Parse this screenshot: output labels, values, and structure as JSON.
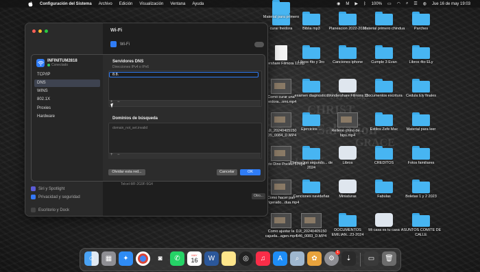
{
  "menubar": {
    "app_name": "Configuración del Sistema",
    "menus": [
      "Archivo",
      "Edición",
      "Visualización",
      "Ventana",
      "Ayuda"
    ],
    "battery": "100%",
    "datetime": "Jue 16 de may  19:03"
  },
  "desktop": {
    "items": [
      {
        "label": "curar freidora",
        "kind": "folder"
      },
      {
        "label": "Biblia mp3",
        "kind": "folder"
      },
      {
        "label": "Planeacion 2022-2023",
        "kind": "folder"
      },
      {
        "label": "Material primero chindua",
        "kind": "folder"
      },
      {
        "label": "Parches",
        "kind": "folder"
      },
      {
        "label": "Wondershare Filmora 11.zip",
        "kind": "file"
      },
      {
        "label": "Libros 4to y 3ro",
        "kind": "folder"
      },
      {
        "label": "Canciones iphone",
        "kind": "folder"
      },
      {
        "label": "Cumple 3 Evan",
        "kind": "folder"
      },
      {
        "label": "Libros 4to ELy",
        "kind": "folder"
      },
      {
        "label": "Como curar una freidora...omi.mp4",
        "kind": "video"
      },
      {
        "label": "examen diagnostico",
        "kind": "folder"
      },
      {
        "label": "Wondershare Filmora 11",
        "kind": "app"
      },
      {
        "label": "Documentos escritura",
        "kind": "folder"
      },
      {
        "label": "Cedula Ely finales",
        "kind": "folder"
      },
      {
        "label": "DJI_20240405150 935_0084_D.MP4",
        "kind": "video"
      },
      {
        "label": "Ejercicios ...",
        "kind": "folder"
      },
      {
        "label": "Relleno chino de ... bips.mp4",
        "kind": "video"
      },
      {
        "label": "Estilos Zefe Mac",
        "kind": "folder"
      },
      {
        "label": "Material para leer",
        "kind": "folder"
      },
      {
        "label": "Proyecto Dino Pocket 3.mp4",
        "kind": "video"
      },
      {
        "label": "Planeacion segundo... de 2024",
        "kind": "folder"
      },
      {
        "label": "Libros",
        "kind": "app"
      },
      {
        "label": "CREDITOS",
        "kind": "folder"
      },
      {
        "label": "Fotos familiares",
        "kind": "folder"
      },
      {
        "label": "Como hacer pan refrigerado...dua.mp4",
        "kind": "video"
      },
      {
        "label": "Canciones navideñas",
        "kind": "folder"
      },
      {
        "label": "Miniaturas",
        "kind": "app"
      },
      {
        "label": "Fabulas",
        "kind": "folder"
      },
      {
        "label": "Boletas 1 y 2 2023",
        "kind": "folder"
      },
      {
        "label": "Como ajustar la cajuela...agen.mp4",
        "kind": "video"
      },
      {
        "label": "DJI_20240405150 546_0083_D.MP4",
        "kind": "video"
      },
      {
        "label": "DOCUMENTOS EMILIAN...23-2024",
        "kind": "folder"
      },
      {
        "label": "Mi casa es tu casa",
        "kind": "app"
      },
      {
        "label": "ASUNTOS COMITE DE CALLE",
        "kind": "folder"
      },
      {
        "label": "Material para primero",
        "kind": "folder"
      }
    ]
  },
  "window": {
    "title": "Wi-Fi",
    "wifi_row_label": "Wi-Fi",
    "sidebar_lower": [
      "Siri y Spotlight",
      "Privacidad y seguridad",
      "Escritorio y Dock"
    ],
    "network_row_fragment": "Telcel-MF-2G9F-5G4",
    "more_button": "Otro..."
  },
  "sheet": {
    "network_name": "INFINITUM2818",
    "network_status": "Conectado",
    "tabs": [
      "TCP/IP",
      "DNS",
      "WINS",
      "802.1X",
      "Proxies",
      "Hardware"
    ],
    "selected_tab": "DNS",
    "dns_title": "Servidores DNS",
    "dns_subtitle": "Direcciones IPv4 o IPv6",
    "dns_value": "8.8.",
    "search_title": "Dominios de búsqueda",
    "search_value": "domain_not_set.invalid",
    "plus": "+",
    "minus": "−",
    "forget_button": "Olvidar esta red...",
    "cancel_button": "Cancelar",
    "ok_button": "OK"
  },
  "dock": {
    "apps": [
      "finder-icon",
      "launchpad-icon",
      "safari-icon",
      "chrome-icon",
      "photo-booth-icon",
      "whatsapp-icon",
      "calendar-icon",
      "word-icon",
      "notes-icon",
      "quicktime-icon",
      "music-icon",
      "app-store-icon",
      "preview-icon",
      "photos-icon",
      "system-settings-icon"
    ],
    "calendar_month": "MAY",
    "calendar_day": "16",
    "settings_badge": "1"
  },
  "colors": {
    "accent": "#2f7cf6",
    "folder": "#47b5f2",
    "connected": "#34c759"
  }
}
